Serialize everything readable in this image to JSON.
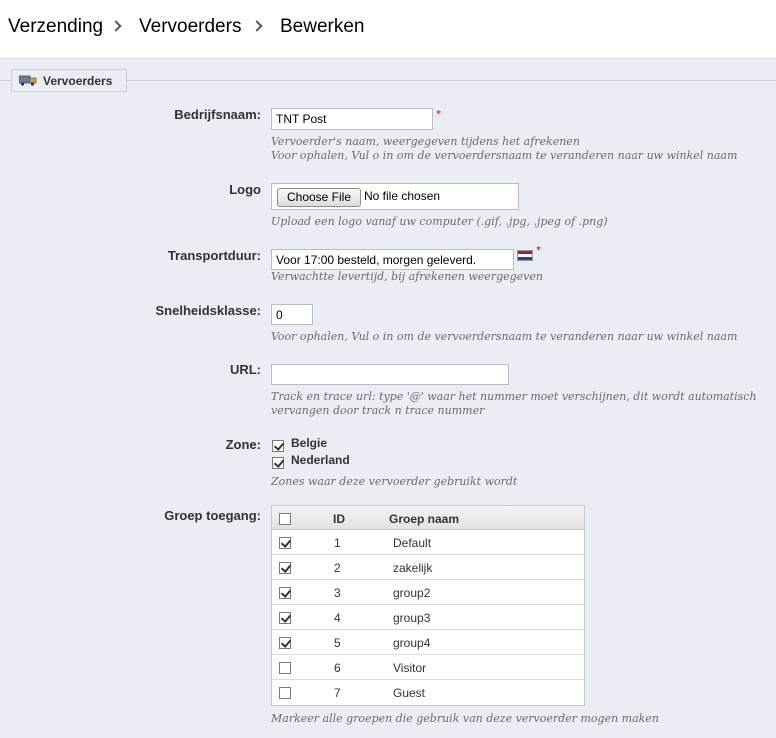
{
  "breadcrumb": [
    "Verzending",
    "Vervoerders",
    "Bewerken"
  ],
  "legend": "Vervoerders",
  "fields": {
    "company": {
      "label": "Bedrijfsnaam:",
      "value": "TNT Post",
      "required": "*",
      "hint1": "Vervoerder's naam, weergegeven tijdens het afrekenen",
      "hint2": "Voor ophalen, Vul o in om de vervoerdersnaam te veranderen naar uw winkel naam"
    },
    "logo": {
      "label": "Logo",
      "button": "Choose File",
      "status": "No file chosen",
      "hint": "Upload een logo vanaf uw computer (.gif, .jpg, .jpeg of .png)"
    },
    "transit": {
      "label": "Transportduur:",
      "value": "Voor 17:00 besteld, morgen geleverd.",
      "required": "*",
      "hint": "Verwachtte levertijd, bij afrekenen weergegeven"
    },
    "speed": {
      "label": "Snelheidsklasse:",
      "value": "0",
      "hint": "Voor ophalen, Vul o in om de vervoerdersnaam te veranderen naar uw winkel naam"
    },
    "url": {
      "label": "URL:",
      "value": "",
      "hint1": "Track en trace url: type '@' waar het nummer moet verschijnen, dit wordt automatisch",
      "hint2": "vervangen door track n trace nummer"
    },
    "zone": {
      "label": "Zone:",
      "items": [
        {
          "name": "Belgie",
          "checked": true
        },
        {
          "name": "Nederland",
          "checked": true
        }
      ],
      "hint": "Zones waar deze vervoerder gebruikt wordt"
    },
    "groups": {
      "label": "Groep toegang:",
      "col_id": "ID",
      "col_name": "Groep naam",
      "rows": [
        {
          "id": "1",
          "name": "Default",
          "checked": true
        },
        {
          "id": "2",
          "name": "zakelijk",
          "checked": true
        },
        {
          "id": "3",
          "name": "group2",
          "checked": true
        },
        {
          "id": "4",
          "name": "group3",
          "checked": true
        },
        {
          "id": "5",
          "name": "group4",
          "checked": true
        },
        {
          "id": "6",
          "name": "Visitor",
          "checked": false
        },
        {
          "id": "7",
          "name": "Guest",
          "checked": false
        }
      ],
      "hint": "Markeer alle groepen die gebruik van deze vervoerder mogen maken"
    }
  },
  "colors": {
    "background": "#ebedf4",
    "required": "#cc0000",
    "flag": [
      "#ae1c28",
      "#ffffff",
      "#21468b"
    ]
  }
}
